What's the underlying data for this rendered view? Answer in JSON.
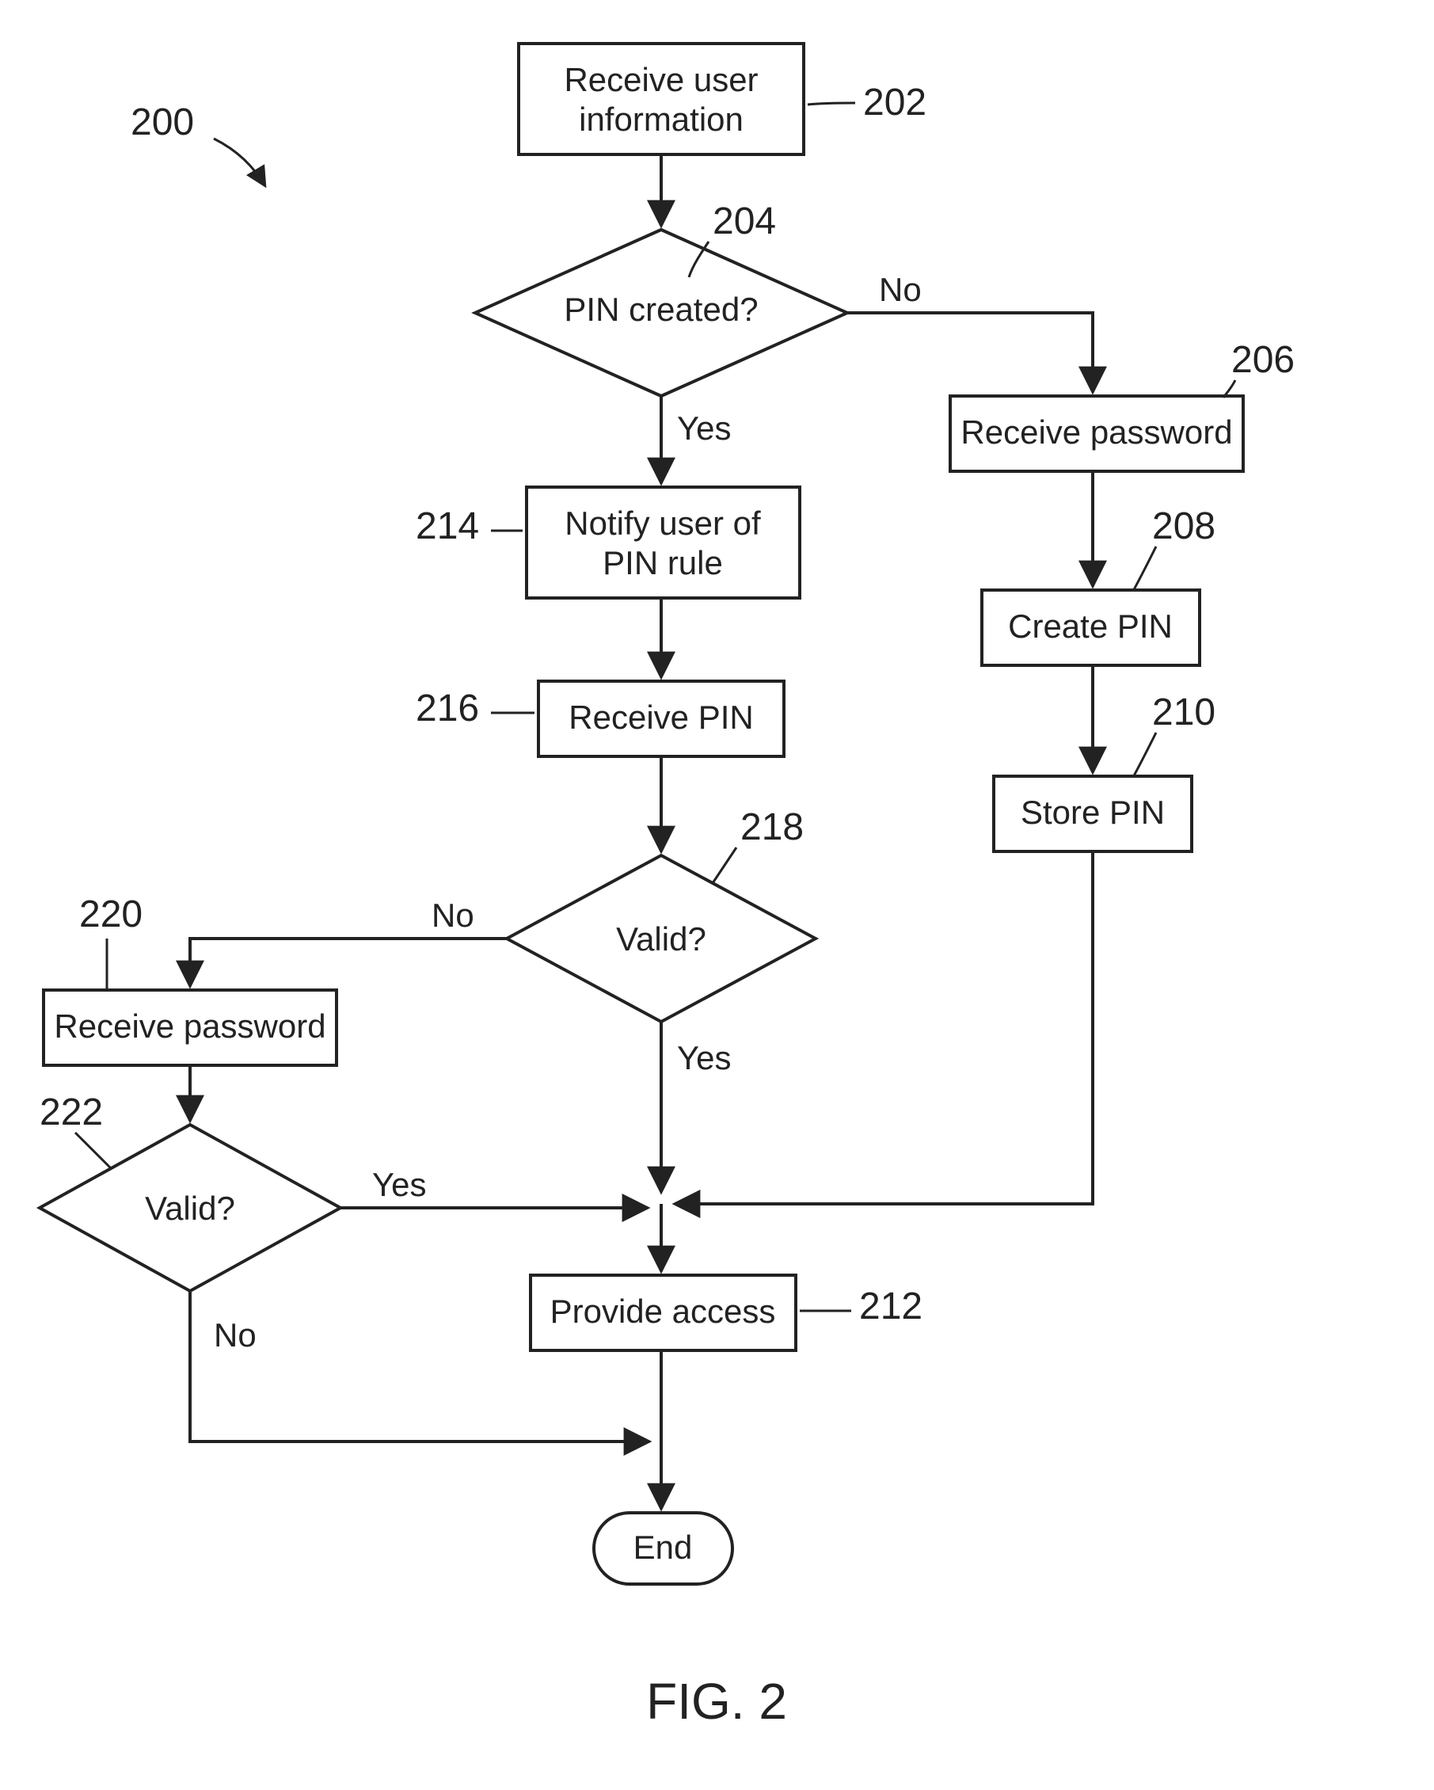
{
  "figure_label": "FIG. 2",
  "diagram_ref": "200",
  "nodes": {
    "n202": {
      "ref": "202",
      "text": "Receive user information"
    },
    "n204": {
      "ref": "204",
      "text": "PIN created?"
    },
    "n206": {
      "ref": "206",
      "text": "Receive password"
    },
    "n208": {
      "ref": "208",
      "text": "Create PIN"
    },
    "n210": {
      "ref": "210",
      "text": "Store PIN"
    },
    "n212": {
      "ref": "212",
      "text": "Provide access"
    },
    "n214": {
      "ref": "214",
      "text": "Notify user of PIN rule"
    },
    "n216": {
      "ref": "216",
      "text": "Receive PIN"
    },
    "n218": {
      "ref": "218",
      "text": "Valid?"
    },
    "n220": {
      "ref": "220",
      "text": "Receive password"
    },
    "n222": {
      "ref": "222",
      "text": "Valid?"
    },
    "end": {
      "text": "End"
    }
  },
  "edge_labels": {
    "n204_no": "No",
    "n204_yes": "Yes",
    "n218_no": "No",
    "n218_yes": "Yes",
    "n222_yes": "Yes",
    "n222_no": "No"
  }
}
